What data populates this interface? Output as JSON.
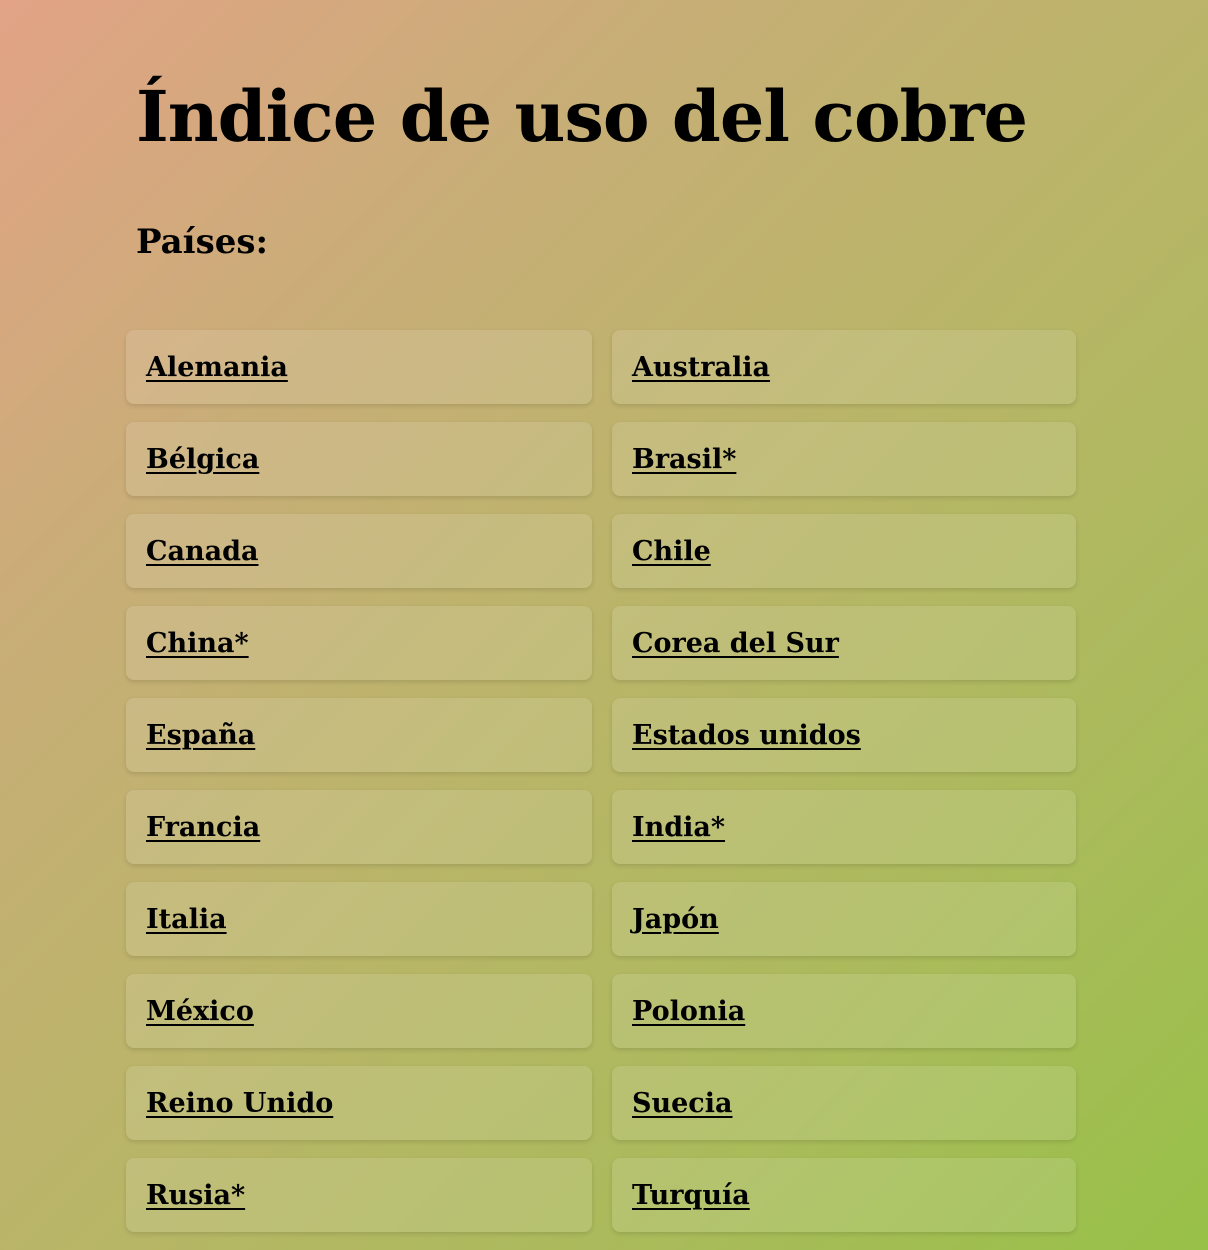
{
  "header": {
    "title": "Índice de uso del cobre",
    "subtitle": "Países:"
  },
  "countries": [
    "Alemania",
    "Australia",
    "Bélgica",
    "Brasil*",
    "Canada",
    "Chile",
    "China*",
    "Corea del Sur",
    "España",
    "Estados unidos",
    "Francia",
    "India*",
    "Italia",
    "Japón",
    "México",
    "Polonia",
    "Reino Unido",
    "Suecia",
    "Rusia*",
    "Turquía"
  ]
}
